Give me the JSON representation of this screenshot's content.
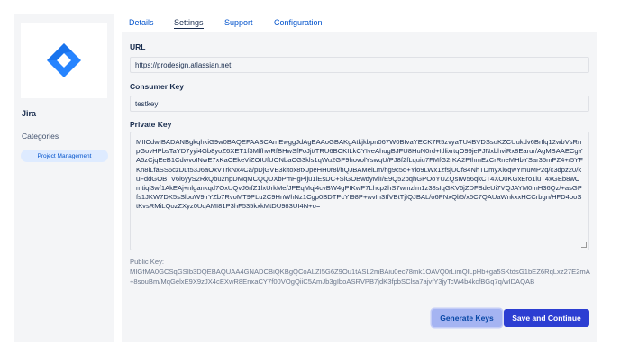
{
  "app": {
    "name": "Jira"
  },
  "sidebar": {
    "categories_label": "Categories",
    "category": "Project Management"
  },
  "tabs": [
    {
      "label": "Details",
      "active": false
    },
    {
      "label": "Settings",
      "active": true
    },
    {
      "label": "Support",
      "active": false
    },
    {
      "label": "Configuration",
      "active": false
    }
  ],
  "form": {
    "url_label": "URL",
    "url_value": "https://prodesign.atlassian.net",
    "consumer_key_label": "Consumer Key",
    "consumer_key_value": "testkey",
    "private_key_label": "Private Key",
    "private_key_value": "MIICdwIBADANBgkqhkiG9w0BAQEFAASCAmEwggJdAgEAAoGBAKgAtkjkbpn067W0BIvaYECK7R5zvyaTU4BVDSsuKZCUukdv6BrIlq12wbVsRnpGovHPbsTaYD7yyi4Gb8yoZ6XET1f3MlfhwRfBHwSfFoJjt/TRU6BCKILkCYIveAhugBJFU8HuN0rd+ItllixrtqO99jePJNxbhviRx8Earur/AgMBAAECgYA5zCjqEeB1CdwvoINwE7xKaCEkeViZOIUfUONbaCG3kls1qWu2GP9hovolYswqU/PJ8f2fLquiu7FMfG2rKA2PIhmEzCrRneMHbYSar35mPZ4+/5YFKn8iLfaSS6czDLt53J6aOxVTrkNx4Ca/pDjGVE3kitox8txJpeHH0r8l/hQJBAMelLm/hg9c5q+Yio9LWx1zfsjUCf84NhTDmyXl6qwYmuMP2q/c3dpz20/kuFddGOBTV6i6yyS2RkQbu2npDMqMCQQDXbPmHgPlju1lEsDC+SiGOBwdyMiI/E9Q52pqhGPOoYUZQsIW56qkCT4XO0KGxEro1iuT4xGEb8wCmtiqi3wf1AkEAj+nlgankqd7OxUQvJ6rfZ1lxUrkMe/JPEqMqj4cvBW4gPIKwP7Lhcp2hS7wmzlm1z38sIqGKV6jZDFBdeUi7VQJAYM0mH36Qz/+asGPfs1JKW7DK5sSlouW9IrYZb7RvoMT9PLu2C9HnWhNz1Cgp0BDTPcYI98P+wvIh3IfVBtTjIQJBAL/o6PNxQl/5/x6C7QAUaWnkxxHCCrbgn/HFD4ooStKvsRMiLQozZXyz0UqAMI81P3hF535kxkMtDU983UI4N+o=",
    "public_key_label": "Public Key:",
    "public_key_value": "MIGfMA0GCSqGSIb3DQEBAQUAA4GNADCBiQKBgQCoALZI5G6Z9Ou1tASL2mBAiu0ec78mk1OAVQ0rLimQlLpHb+ga5SKtdsG1bEZ6RqLxz27E2mA+8souBm/MqGelxE9X9zJX4cEXwR8EnxaCY7f00VOgQiiC5AmJb3gIboASRVPB7jdK3fpbSClsa7ajvfY3jyTcW4b4kcfBGq7q/wIDAQAB"
  },
  "buttons": {
    "generate": "Generate Keys",
    "save": "Save and Continue"
  },
  "colors": {
    "jira_blue": "#2684ff",
    "primary": "#2c3ed2",
    "link": "#0052cc"
  }
}
